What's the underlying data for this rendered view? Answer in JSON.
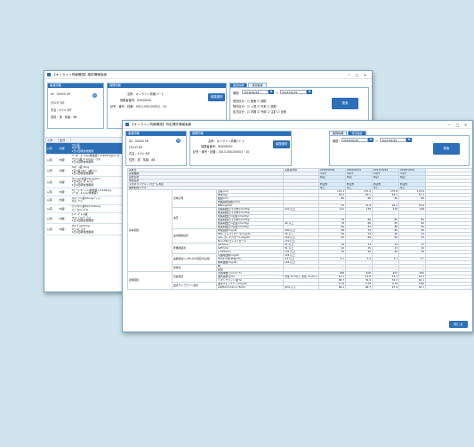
{
  "back_window": {
    "title": "【オンライン資格確認】薬剤情報画面",
    "controls": [
      "─",
      "□",
      "✕"
    ],
    "patient": {
      "header": "患者情報",
      "id_label": "ID：",
      "id_value": "00000 26",
      "kana": "ﾋﾖｳｼﾖｳ ﾀﾛｳ",
      "name_label": "氏名：",
      "name_value": "ｵﾝﾗｲﾝ ﾀﾛｳ",
      "sex_label": "性別：",
      "sex_value": "男",
      "age_label": "年齢：",
      "age_value": "88"
    },
    "insurance": {
      "header": "保険情報",
      "type_label": "名称：",
      "type_value": "オンライン資格ｺｰﾄﾞ1",
      "insurer_label": "保険者番号：",
      "insurer_value": "00000000",
      "symbol_label": "記号・番号・枝番：",
      "symbol_value": "0013-000100001・10",
      "button": "保険選択"
    },
    "search": {
      "tabs": [
        "薬剤情報",
        "特定健診"
      ],
      "period_label": "期間：",
      "from": "2018/09/29",
      "to": "2021/09/29",
      "tilde": "〜",
      "row1": "受診区分：☑ 医療  ☑ 調剤",
      "row2": "院外区分：☑ 入院  ☑ 外来  ☑ 調剤",
      "row3": "処方区分：☑ 内服  ☑ 外用  ☑ 注射  ☑ 全般",
      "button": "検索"
    },
    "table": {
      "headers": [
        "入外",
        "区分",
        "薬剤情報",
        "数量"
      ],
      "rows": [
        {
          "io": "入院",
          "kind": "内服",
          "med": "ﾌﾜﾗﾝ錠\n1回1錠\n1日1回朝食後服用",
          "qty": "1錠",
          "selected": true
        },
        {
          "io": "入院",
          "kind": "内服",
          "med": "ﾒﾌﾟﾛﾊﾞｰﾙ ﾌｨﾙﾑ(徐放錠）0.625mg(ﾙﾆｰﾜ)\nﾌﾜﾌｧﾘﾝ錠 0.1mg(ﾊﾞｲｴﾙ)\n1日1回朝食後服用",
          "qty": "2錠",
          "selected": false
        },
        {
          "io": "入院",
          "kind": "内服",
          "med": "ｱﾑﾛｼﾞﾝ錠 5mg\n1日1錠 ｱﾑﾛｼﾞﾝ錠(ﾃｽ)\n1日1回朝食後服用",
          "qty": "1錠",
          "selected": false
        },
        {
          "io": "入院",
          "kind": "内服",
          "med": "ﾗｷｿﾌｪﾝOD錠10mg(ｱﾙﾂ)\n1日1回ｺﾞｸﾀﾞﾙ(ﾃｽ)\n1日1回朝食後服用",
          "qty": "1錠",
          "selected": false
        },
        {
          "io": "入院",
          "kind": "内服",
          "med": "ｱｽﾋﾟﾘﾝ ﾀﾌﾞﾚｯﾄ(徐放錠) 0.625mg\nﾒﾌﾟﾛﾊﾞｰﾙﾌｨﾙﾑ(徐放錠)",
          "qty": "",
          "selected": false
        },
        {
          "io": "入院",
          "kind": "内服",
          "med": "ｽｴﾙｼﾞｱﾆﾝ錠20mg(ﾊﾞﾚﾝ)\nｽｴﾙｼﾞｱﾆﾝ",
          "qty": "",
          "selected": false
        },
        {
          "io": "入院",
          "kind": "内服",
          "med": "ｾﾌﾄﾘｱｷｿﾝ錠500 500mg\nﾌﾗｼﾞｵﾏｲｼﾝ(ﾃｽ)",
          "qty": "",
          "selected": false
        },
        {
          "io": "入院",
          "kind": "内服",
          "med": "ｴｰﾊﾞｰｸﾞﾙｰｶ錠\nｱｸﾄｽ ﾌﾞﾛｯｸﾞ(ﾃｽ)\n1日1回朝食後服用",
          "qty": "",
          "selected": false
        },
        {
          "io": "入院",
          "kind": "内服",
          "med": "ｱﾀﾅｰｸﾞﾙﾛﾝ5mg\nﾏｲﾅｰﾛｸﾞ(ﾃｽ)\n1日1回朝食後服用",
          "qty": "",
          "selected": false
        }
      ]
    }
  },
  "front_window": {
    "title": "【オンライン資格確認】特定健診情報画面",
    "controls": [
      "─",
      "□",
      "✕"
    ],
    "patient": {
      "header": "患者情報",
      "id_label": "ID：",
      "id_value": "00000 26",
      "kana": "ﾋﾖｳｼﾖｳ ﾀﾛｳ",
      "name_label": "氏名：",
      "name_value": "ｵﾝﾗｲﾝ ﾀﾛｳ",
      "sex_label": "性別：",
      "sex_value": "男",
      "age_label": "年齢：",
      "age_value": "88"
    },
    "insurance": {
      "header": "保険情報",
      "type_label": "名称：",
      "type_value": "オンライン資格ｺｰﾄﾞ1",
      "insurer_label": "保険者番号：",
      "insurer_value": "00000000",
      "symbol_label": "記号・番号・枝番：",
      "symbol_value": "0013-000100001・10",
      "button": "保険選択"
    },
    "search": {
      "tabs": [
        "薬剤情報",
        "特定健診"
      ],
      "period_label": "期間：",
      "from": "2018/09/29",
      "to": "2021/09/29",
      "tilde": "〜",
      "button": "検索"
    },
    "grid": {
      "top_rows": [
        {
          "label": "実施日",
          "ref": "実施基準値",
          "vals": [
            "2018/09/29",
            "2019/09/21",
            "2017/09/22",
            "2018/10/24"
          ]
        },
        {
          "label": "実施機関",
          "ref": "",
          "vals": [
            "ﾍﾙｽｹｱ",
            "ﾍﾙｽｹｱ",
            "ﾍﾙｽｹｱ",
            "ﾍﾙｽｹｱ"
          ]
        },
        {
          "label": "自覚症状",
          "ref": "",
          "vals": [
            "特記",
            "特記",
            "特記",
            "特記"
          ]
        },
        {
          "label": "他覚症状",
          "ref": "",
          "vals": [
            "",
            "",
            "",
            ""
          ]
        },
        {
          "label": "メタボリックシンドローム判定",
          "ref": "",
          "vals": [
            "判定外",
            "判定外",
            "判定外",
            "判定外"
          ]
        },
        {
          "label": "保健指導レベル",
          "ref": "",
          "vals": [
            "なし",
            "なし",
            "なし",
            "なし"
          ]
        }
      ],
      "sections": [
        {
          "category": "基本項目",
          "groups": [
            {
              "name": "身体計測",
              "items": [
                {
                  "label": "身長(cm)",
                  "ref": "",
                  "vals": [
                    "170.1",
                    "170.2",
                    "170.8",
                    "170.6"
                  ]
                },
                {
                  "label": "体重(kg)",
                  "ref": "",
                  "vals": [
                    "56.2",
                    "56.1",
                    "56.4",
                    "57.1"
                  ]
                },
                {
                  "label": "腹囲(cm)",
                  "ref": "",
                  "vals": [
                    "80",
                    "80",
                    "80",
                    "80"
                  ]
                },
                {
                  "label": "内臓脂肪面積(cm2)",
                  "ref": "",
                  "vals": [
                    "",
                    "",
                    "",
                    ""
                  ]
                },
                {
                  "label": "BMI(kg/m2)",
                  "ref": "",
                  "vals": [
                    "25",
                    "24.9",
                    "25.4",
                    "23.9"
                  ]
                }
              ]
            },
            {
              "name": "血圧",
              "items": [
                {
                  "label": "収縮期血圧(その他)(mmHg)",
                  "ref": "140 以上",
                  "vals": [
                    "141",
                    "138",
                    "145",
                    "148"
                  ]
                },
                {
                  "label": "拡張期血圧(その他)(mmHg)",
                  "ref": "",
                  "vals": [
                    "",
                    "",
                    "",
                    ""
                  ]
                },
                {
                  "label": "収縮期血圧(1回目)(mmHg)",
                  "ref": "",
                  "vals": [
                    "",
                    "",
                    "",
                    ""
                  ]
                },
                {
                  "label": "拡張期血圧(その他)(mmHg)",
                  "ref": "",
                  "vals": [
                    "79",
                    "80",
                    "85",
                    "82"
                  ]
                },
                {
                  "label": "拡張期血圧(1回目)(mmHg)",
                  "ref": "90 以上",
                  "vals": [
                    "79",
                    "80",
                    "85",
                    "82"
                  ]
                },
                {
                  "label": "拡張期血圧(2回目)(mmHg)",
                  "ref": "",
                  "vals": [
                    "80",
                    "81",
                    "86",
                    "83"
                  ]
                }
              ]
            },
            {
              "name": "血中脂質検査",
              "items": [
                {
                  "label": "中性脂肪(mg/dl)",
                  "ref": "300 以上",
                  "vals": [
                    "68",
                    "70",
                    "80",
                    "50"
                  ]
                },
                {
                  "label": "HDL-コレステロール(mg/dl)",
                  "ref": "34 以下",
                  "vals": [
                    "56",
                    "52",
                    "48",
                    "43"
                  ]
                },
                {
                  "label": "LDL-コレステロール(mg/dl)",
                  "ref": "140 以上",
                  "vals": [
                    "90",
                    "89",
                    "94",
                    "92"
                  ]
                },
                {
                  "label": "Non-HDLコレステロール",
                  "ref": "170 以上",
                  "vals": [
                    "",
                    "",
                    "",
                    ""
                  ]
                }
              ]
            },
            {
              "name": "肝機能検査",
              "items": [
                {
                  "label": "GOT(U/L)",
                  "ref": "51 以上",
                  "vals": [
                    "19",
                    "23",
                    "24",
                    "27"
                  ]
                },
                {
                  "label": "GPT(U/L)",
                  "ref": "51 以上",
                  "vals": [
                    "22",
                    "25",
                    "23",
                    "20"
                  ]
                },
                {
                  "label": "γ-GTP(U/L)",
                  "ref": "101 以上",
                  "vals": [
                    "24",
                    "40",
                    "30",
                    "50"
                  ]
                }
              ]
            },
            {
              "name": "血糖検査(いずれかの項目の実施)",
              "items": [
                {
                  "label": "空腹時血糖(mg/dl)",
                  "ref": "126 以上",
                  "vals": [
                    "",
                    "",
                    "",
                    ""
                  ]
                },
                {
                  "label": "HbA1c(NGSP値)(%)",
                  "ref": "6.5 以上",
                  "vals": [
                    "5.1",
                    "5.3",
                    "5.1",
                    "5.7"
                  ]
                },
                {
                  "label": "随時血糖(mg/dl)",
                  "ref": "126 以上",
                  "vals": [
                    "",
                    "",
                    "",
                    ""
                  ]
                }
              ]
            },
            {
              "name": "尿検査",
              "items": [
                {
                  "label": "糖",
                  "ref": "",
                  "vals": [
                    "－",
                    "－",
                    "－",
                    "－"
                  ]
                },
                {
                  "label": "蛋白",
                  "ref": "",
                  "vals": [
                    "－",
                    "－",
                    "－",
                    "－"
                  ]
                }
              ]
            }
          ]
        },
        {
          "category": "詳細項目",
          "groups": [
            {
              "name": "貧血検査",
              "items": [
                {
                  "label": "赤血球数(万/mm^3)",
                  "ref": "",
                  "vals": [
                    "398",
                    "408",
                    "402",
                    "400"
                  ]
                },
                {
                  "label": "血色素量(g/dl)",
                  "ref": "男性 12.0以下 女性 11.0以下",
                  "vals": [
                    "14.1",
                    "13.8",
                    "15.1",
                    "14.2"
                  ]
                },
                {
                  "label": "ヘマトクリット値(%)",
                  "ref": "",
                  "vals": [
                    "38.7",
                    "35.6",
                    "32.2",
                    "32.1"
                  ]
                }
              ]
            },
            {
              "name": "血清クレアチニン検査",
              "items": [
                {
                  "label": "血清クレアチニン(mg/dl)",
                  "ref": "",
                  "vals": [
                    "0.79",
                    "0.78",
                    "0.79",
                    "0.80"
                  ]
                },
                {
                  "label": "eGFR(ml/min/1.73m2)",
                  "ref": "45.0 以下",
                  "vals": [
                    "66.1",
                    "66.7",
                    "67.4",
                    "64.7"
                  ]
                }
              ]
            }
          ]
        }
      ]
    },
    "close_button": "閉じる"
  }
}
